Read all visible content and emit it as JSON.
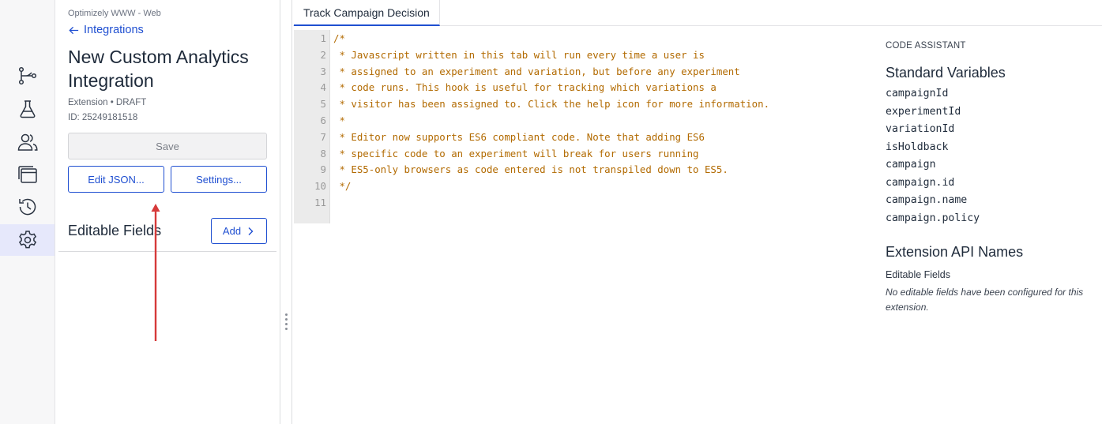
{
  "rail": {
    "items": [
      {
        "icon": "flow-branch-icon",
        "active": false
      },
      {
        "icon": "flask-icon",
        "active": false
      },
      {
        "icon": "users-icon",
        "active": false
      },
      {
        "icon": "windows-icon",
        "active": false
      },
      {
        "icon": "history-icon",
        "active": false
      },
      {
        "icon": "gear-icon",
        "active": true
      }
    ]
  },
  "panel": {
    "project": "Optimizely WWW - Web",
    "back_label": "Integrations",
    "title": "New Custom Analytics Integration",
    "meta_type": "Extension • DRAFT",
    "meta_id": "ID: 25249181518",
    "save_label": "Save",
    "edit_json_label": "Edit JSON...",
    "settings_label": "Settings...",
    "editable_fields_title": "Editable Fields",
    "add_label": "Add"
  },
  "annotation": {
    "arrow_color": "#d63a3a"
  },
  "tabs": [
    {
      "label": "Track Campaign Decision",
      "active": true
    }
  ],
  "editor": {
    "lines": [
      {
        "n": "1",
        "text": "/*"
      },
      {
        "n": "2",
        "text": " * Javascript written in this tab will run every time a user is"
      },
      {
        "n": "3",
        "text": " * assigned to an experiment and variation, but before any experiment"
      },
      {
        "n": "4",
        "text": " * code runs. This hook is useful for tracking which variations a"
      },
      {
        "n": "5",
        "text": " * visitor has been assigned to. Click the help icon for more information."
      },
      {
        "n": "6",
        "text": " *"
      },
      {
        "n": "7",
        "text": " * Editor now supports ES6 compliant code. Note that adding ES6"
      },
      {
        "n": "8",
        "text": " * specific code to an experiment will break for users running"
      },
      {
        "n": "9",
        "text": " * ES5-only browsers as code entered is not transpiled down to ES5."
      },
      {
        "n": "10",
        "text": " */"
      },
      {
        "n": "11",
        "text": ""
      }
    ]
  },
  "assistant": {
    "heading": "CODE ASSISTANT",
    "standard_vars_title": "Standard Variables",
    "variables": [
      "campaignId",
      "experimentId",
      "variationId",
      "isHoldback",
      "campaign",
      "campaign.id",
      "campaign.name",
      "campaign.policy"
    ],
    "api_names_title": "Extension API Names",
    "editable_fields_label": "Editable Fields",
    "no_fields_note": "No editable fields have been configured for this extension."
  },
  "colors": {
    "accent": "#1f4fd1",
    "code_comment": "#b26a00",
    "active_rail": "#e6e8fb"
  }
}
